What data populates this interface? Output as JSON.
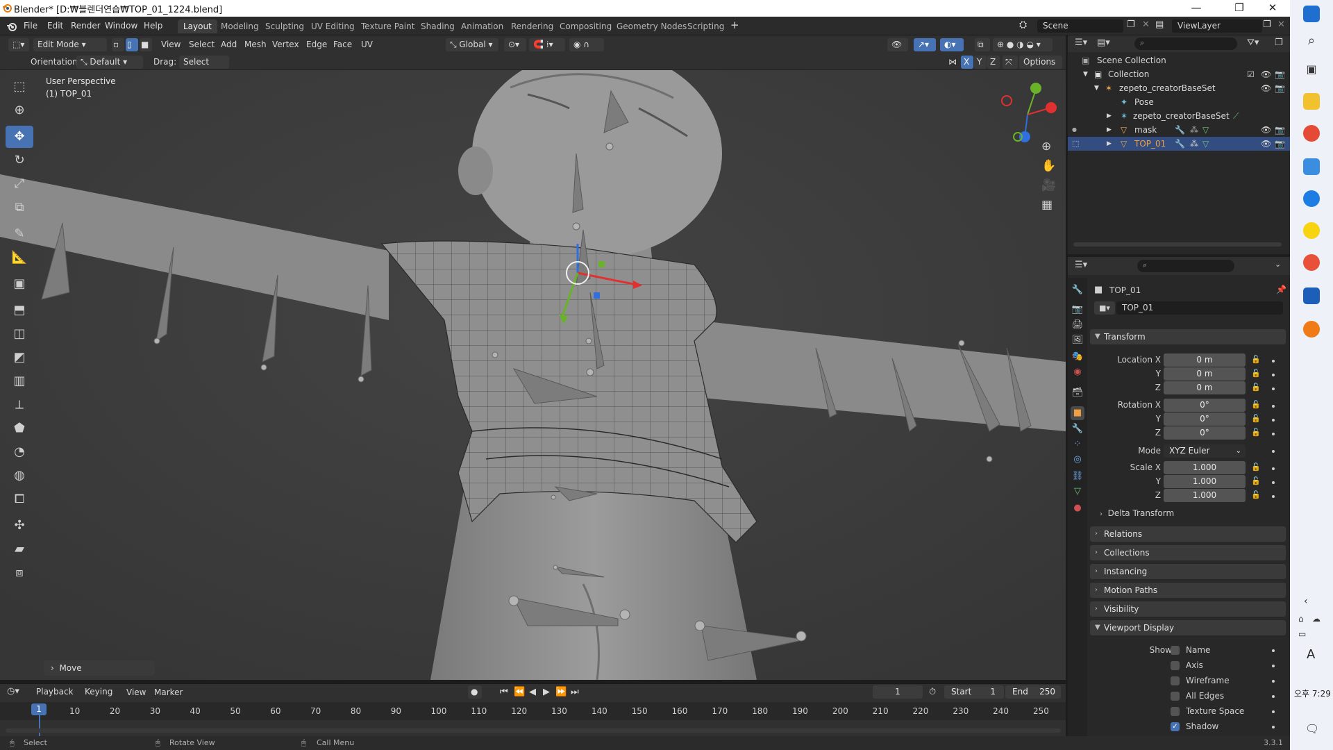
{
  "window": {
    "title": "Blender* [D:₩블렌더연습₩TOP_01_1224.blend]",
    "minimize": "—",
    "maximize": "❐",
    "close": "✕"
  },
  "menu": [
    "File",
    "Edit",
    "Render",
    "Window",
    "Help"
  ],
  "workspaces": [
    "Layout",
    "Modeling",
    "Sculpting",
    "UV Editing",
    "Texture Paint",
    "Shading",
    "Animation",
    "Rendering",
    "Compositing",
    "Geometry Nodes",
    "Scripting"
  ],
  "active_workspace": "Layout",
  "scene": "Scene",
  "view_layer": "ViewLayer",
  "viewport_header": {
    "mode": "Edit Mode",
    "menus": [
      "View",
      "Select",
      "Add",
      "Mesh",
      "Vertex",
      "Edge",
      "Face",
      "UV"
    ],
    "transform_orientation": "Global",
    "orientation_label": "Orientation:",
    "orientation_value": "Default",
    "drag_label": "Drag:",
    "drag_value": "Select Box",
    "axes": [
      "X",
      "Y",
      "Z"
    ],
    "options": "Options"
  },
  "viewport": {
    "perspective": "User Perspective",
    "object": "(1) TOP_01",
    "last_op": "Move"
  },
  "outliner": {
    "root": "Scene Collection",
    "items": [
      {
        "label": "Collection",
        "depth": 1
      },
      {
        "label": "zepeto_creatorBaseSet",
        "depth": 2
      },
      {
        "label": "Pose",
        "depth": 3
      },
      {
        "label": "zepeto_creatorBaseSet",
        "depth": 3
      },
      {
        "label": "mask",
        "depth": 3
      },
      {
        "label": "TOP_01",
        "depth": 3,
        "selected": true
      }
    ]
  },
  "properties": {
    "object_name": "TOP_01",
    "data_name": "TOP_01",
    "transform": {
      "header": "Transform",
      "location_label": "Location X",
      "location": [
        "0 m",
        "0 m",
        "0 m"
      ],
      "rotation_label": "Rotation X",
      "rotation": [
        "0°",
        "0°",
        "0°"
      ],
      "mode_label": "Mode",
      "mode": "XYZ Euler",
      "scale_label": "Scale X",
      "scale": [
        "1.000",
        "1.000",
        "1.000"
      ],
      "y": "Y",
      "z": "Z",
      "delta": "Delta Transform"
    },
    "panels": [
      "Relations",
      "Collections",
      "Instancing",
      "Motion Paths",
      "Visibility",
      "Viewport Display"
    ],
    "viewport_display": {
      "show_label": "Show",
      "items": [
        {
          "label": "Name",
          "checked": false
        },
        {
          "label": "Axis",
          "checked": false
        },
        {
          "label": "Wireframe",
          "checked": false
        },
        {
          "label": "All Edges",
          "checked": false
        },
        {
          "label": "Texture Space",
          "checked": false
        },
        {
          "label": "Shadow",
          "checked": true
        }
      ]
    }
  },
  "timeline": {
    "menus": [
      "Playback",
      "Keying",
      "View",
      "Marker"
    ],
    "current_frame": "1",
    "start_label": "Start",
    "start": "1",
    "end_label": "End",
    "end": "250",
    "ticks": [
      "1",
      "10",
      "20",
      "30",
      "40",
      "50",
      "60",
      "70",
      "80",
      "90",
      "100",
      "110",
      "120",
      "130",
      "140",
      "150",
      "160",
      "170",
      "180",
      "190",
      "200",
      "210",
      "220",
      "230",
      "240",
      "250"
    ]
  },
  "statusbar": {
    "select": "Select",
    "rotate": "Rotate View",
    "call_menu": "Call Menu",
    "version": "3.3.1"
  },
  "taskbar": {
    "clock": "오후 7:29",
    "ime": "A"
  }
}
